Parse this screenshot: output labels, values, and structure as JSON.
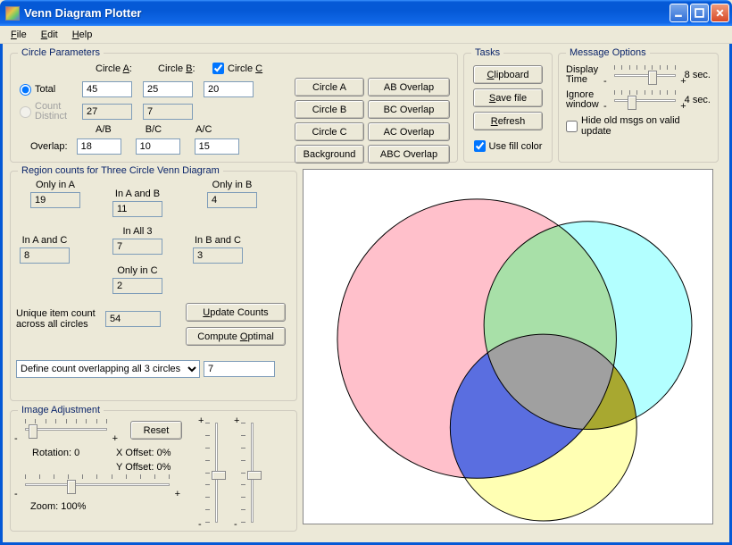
{
  "window": {
    "title": "Venn Diagram Plotter"
  },
  "menu": {
    "file": "File",
    "edit": "Edit",
    "help": "Help"
  },
  "params": {
    "legend": "Circle Parameters",
    "circleA_label": "Circle A:",
    "circleB_label": "Circle B:",
    "circleC_label": "Circle C",
    "circleC_checked": true,
    "total_label": "Total",
    "total_selected": true,
    "countDistinct_label": "Count Distinct",
    "countDistinct_selected": false,
    "totalA": "45",
    "totalB": "25",
    "totalC": "20",
    "cdA": "27",
    "cdB": "7",
    "cdC": "",
    "overlap_label": "Overlap:",
    "ab_label": "A/B",
    "bc_label": "B/C",
    "ac_label": "A/C",
    "ov_ab": "18",
    "ov_bc": "10",
    "ov_ac": "15",
    "buttons": {
      "circleA": "Circle A",
      "abov": "AB Overlap",
      "circleB": "Circle B",
      "bcov": "BC Overlap",
      "circleC": "Circle C",
      "acov": "AC Overlap",
      "background": "Background",
      "abcov": "ABC Overlap"
    }
  },
  "tasks": {
    "legend": "Tasks",
    "clipboard": "Clipboard",
    "savefile": "Save file",
    "refresh": "Refresh",
    "usefill_label": "Use fill color",
    "usefill_checked": true
  },
  "msg": {
    "legend": "Message Options",
    "displayTime_label": "Display Time",
    "displayTime_value": "8 sec.",
    "ignoreWindow_label": "Ignore window",
    "ignoreWindow_value": "4 sec.",
    "hideOld_label": "Hide old msgs on valid update",
    "hideOld_checked": false
  },
  "regions": {
    "legend": "Region counts for Three Circle Venn Diagram",
    "onlyA_label": "Only in A",
    "onlyA": "19",
    "inAB_label": "In A and B",
    "inAB": "11",
    "onlyB_label": "Only in B",
    "onlyB": "4",
    "inAC_label": "In A and C",
    "inAC": "8",
    "inAll3_label": "In All 3",
    "inAll3": "7",
    "inBC_label": "In B and C",
    "inBC": "3",
    "onlyC_label": "Only in C",
    "onlyC": "2",
    "unique_label": "Unique item count across all circles",
    "unique": "54",
    "updateCounts": "Update Counts",
    "computeOptimal": "Compute Optimal",
    "dropdown_selected": "Define count overlapping all 3 circles",
    "dropdown_value": "7"
  },
  "imgadj": {
    "legend": "Image Adjustment",
    "reset": "Reset",
    "rotation_label": "Rotation: 0",
    "xoffset_label": "X Offset: 0%",
    "yoffset_label": "Y Offset: 0%",
    "zoom_label": "Zoom: 100%"
  },
  "chart_data": {
    "type": "venn3",
    "sets": [
      {
        "name": "A",
        "total": 45,
        "color": "#ffc0cb"
      },
      {
        "name": "B",
        "total": 25,
        "color": "#b3ffff"
      },
      {
        "name": "C",
        "total": 20,
        "color": "#ffffb3"
      }
    ],
    "overlaps": {
      "AB": 18,
      "BC": 10,
      "AC": 15,
      "ABC": 7
    },
    "region_counts": {
      "onlyA": 19,
      "onlyB": 4,
      "onlyC": 2,
      "AB_only": 11,
      "AC_only": 8,
      "BC_only": 3,
      "ABC": 7
    },
    "region_colors": {
      "onlyA": "#ffc0cb",
      "onlyB": "#b3ffff",
      "onlyC": "#ffffb3",
      "AB": "#a8e0a8",
      "AC": "#5a6ee0",
      "BC": "#a8a830",
      "ABC": "#a0a0a0"
    },
    "unique_total": 54,
    "background": "#ffffff"
  }
}
